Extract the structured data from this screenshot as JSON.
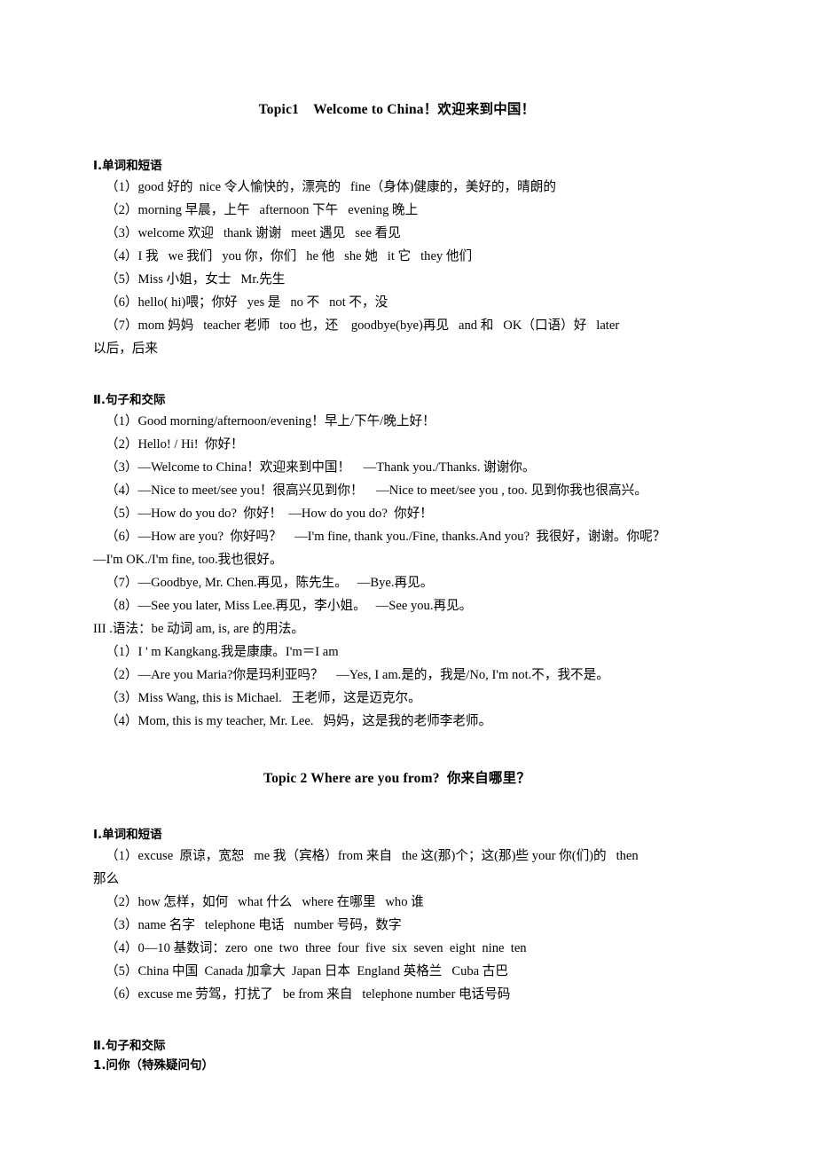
{
  "document": {
    "type": "study-notes",
    "language": "zh-CN",
    "subject": "English vocabulary and phrases study notes"
  },
  "topic1": {
    "title": "Topic1    Welcome to China！欢迎来到中国！",
    "section1": {
      "heading": "Ⅰ.单词和短语",
      "items": [
        "（1）good 好的  nice 令人愉快的，漂亮的   fine（身体)健康的，美好的，晴朗的",
        "（2）morning 早晨，上午   afternoon 下午   evening 晚上",
        "（3）welcome 欢迎   thank 谢谢   meet 遇见   see 看见",
        "（4）I 我   we 我们   you 你，你们   he 他   she 她   it 它   they 他们",
        "（5）Miss 小姐，女士   Mr.先生",
        "（6）hello( hi)喂；你好   yes 是   no 不   not 不，没",
        "（7）mom 妈妈   teacher 老师   too 也，还    goodbye(bye)再见   and 和   OK（口语）好   later"
      ],
      "continuation": "以后，后来"
    },
    "section2": {
      "heading": "Ⅱ.句子和交际",
      "items": [
        "（1）Good morning/afternoon/evening！早上/下午/晚上好！",
        "（2）Hello! / Hi!  你好！",
        "（3）—Welcome to China！欢迎来到中国！    —Thank you./Thanks. 谢谢你。",
        "（4）—Nice to meet/see you！很高兴见到你！    —Nice to meet/see you , too. 见到你我也很高兴。",
        "（5）—How do you do?  你好！  —How do you do?  你好！",
        "（6）—How are you?  你好吗？    —I'm fine, thank you./Fine, thanks.And you?  我很好，谢谢。你呢？"
      ],
      "continuation6": "—I'm OK./I'm fine, too.我也很好。",
      "items_after": [
        "（7）—Goodbye, Mr. Chen.再见，陈先生。   —Bye.再见。",
        "（8）—See you later, Miss Lee.再见，李小姐。   —See you.再见。"
      ]
    },
    "section3": {
      "heading": "III .语法：be 动词 am, is, are 的用法。",
      "items": [
        "（1）I ' m Kangkang.我是康康。I'm＝I am",
        "（2）—Are you Maria?你是玛利亚吗？    —Yes, I am.是的，我是/No, I'm not.不，我不是。",
        "（3）Miss Wang, this is Michael.   王老师，这是迈克尔。",
        "（4）Mom, this is my teacher, Mr. Lee.   妈妈，这是我的老师李老师。"
      ]
    }
  },
  "topic2": {
    "title": "Topic 2 Where are you from?  你来自哪里？",
    "section1": {
      "heading": "Ⅰ.单词和短语",
      "items": [
        "（1）excuse  原谅，宽恕   me 我（宾格）from 来自   the 这(那)个；这(那)些 your 你(们)的   then",
        "（2）how 怎样，如何   what 什么   where 在哪里   who 谁",
        "（3）name 名字   telephone 电话   number 号码，数字",
        "（4）0—10 基数词：zero  one  two  three  four  five  six  seven  eight  nine  ten",
        "（5）China 中国  Canada 加拿大  Japan 日本  England 英格兰   Cuba 古巴",
        "（6）excuse me 劳驾，打扰了   be from 来自   telephone number 电话号码"
      ],
      "continuation": "那么"
    },
    "section2": {
      "heading": "Ⅱ.句子和交际",
      "subheading": "1.问你（特殊疑问句）"
    }
  }
}
